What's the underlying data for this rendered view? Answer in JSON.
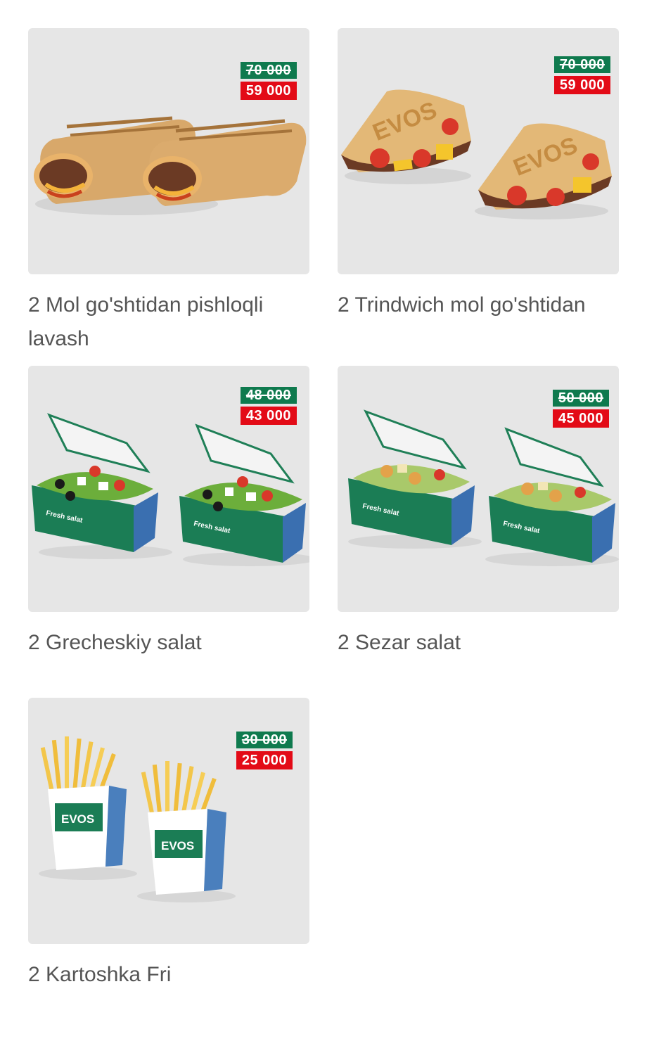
{
  "products": [
    {
      "title": "2 Mol go'shtidan pishloqli lavash",
      "old_price": "70 000",
      "new_price": "59 000",
      "image": "lavash-image"
    },
    {
      "title": "2 Trindwich mol go'shtidan",
      "old_price": "70 000",
      "new_price": "59 000",
      "image": "trindwich-image"
    },
    {
      "title": "2 Grecheskiy salat",
      "old_price": "48 000",
      "new_price": "43 000",
      "image": "greek-salad-image"
    },
    {
      "title": "2 Sezar salat",
      "old_price": "50 000",
      "new_price": "45 000",
      "image": "caesar-salad-image"
    },
    {
      "title": "2 Kartoshka Fri",
      "old_price": "30 000",
      "new_price": "25 000",
      "image": "fries-image"
    }
  ],
  "packaging_text": {
    "brand": "EVOS",
    "salad_box": "Fresh salat"
  },
  "colors": {
    "card_bg": "#e6e6e6",
    "old_price_bg": "#0f7a4e",
    "new_price_bg": "#e30b17",
    "title_text": "#555555"
  }
}
